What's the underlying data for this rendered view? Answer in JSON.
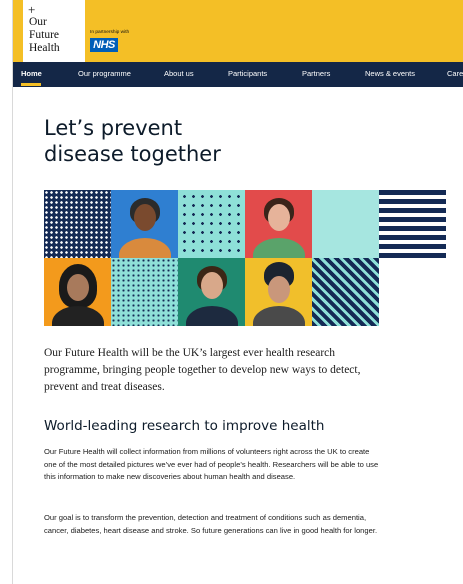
{
  "header": {
    "logo_plus": "+",
    "logo_lines": [
      "Our",
      "Future",
      "Health"
    ],
    "partnership_text": "In partnership with",
    "nhs_label": "NHS"
  },
  "nav": {
    "items": [
      "Home",
      "Our programme",
      "About us",
      "Participants",
      "Partners",
      "News & events",
      "Caree"
    ],
    "active": "Home"
  },
  "hero": {
    "title_line1": "Let’s prevent",
    "title_line2": "disease together"
  },
  "intro": "Our Future Health will be the UK’s largest ever health research programme, bringing people together to develop new ways to detect, prevent and treat diseases.",
  "section": {
    "heading": "World-leading research to improve health",
    "paragraph1": "Our Future Health will collect information from millions of volunteers right across the UK to create one of the most detailed pictures we’ve ever had of people’s health. Researchers will be able to use this information to make new discoveries about human health and disease.",
    "paragraph2": "Our goal is to transform the prevention, detection and treatment of conditions such as dementia, cancer, diabetes, heart disease and stroke. So future generations can live in good health for longer."
  },
  "colors": {
    "yellow": "#f4bf26",
    "navy": "#142747",
    "nhs_blue": "#005eb8",
    "teal": "#8ee0d8",
    "blue_tile": "#2f7fd1",
    "red_tile": "#e24b4b",
    "orange_tile": "#f39a1c",
    "green_tile": "#1f8a70",
    "gold_tile": "#f1bf2b"
  }
}
